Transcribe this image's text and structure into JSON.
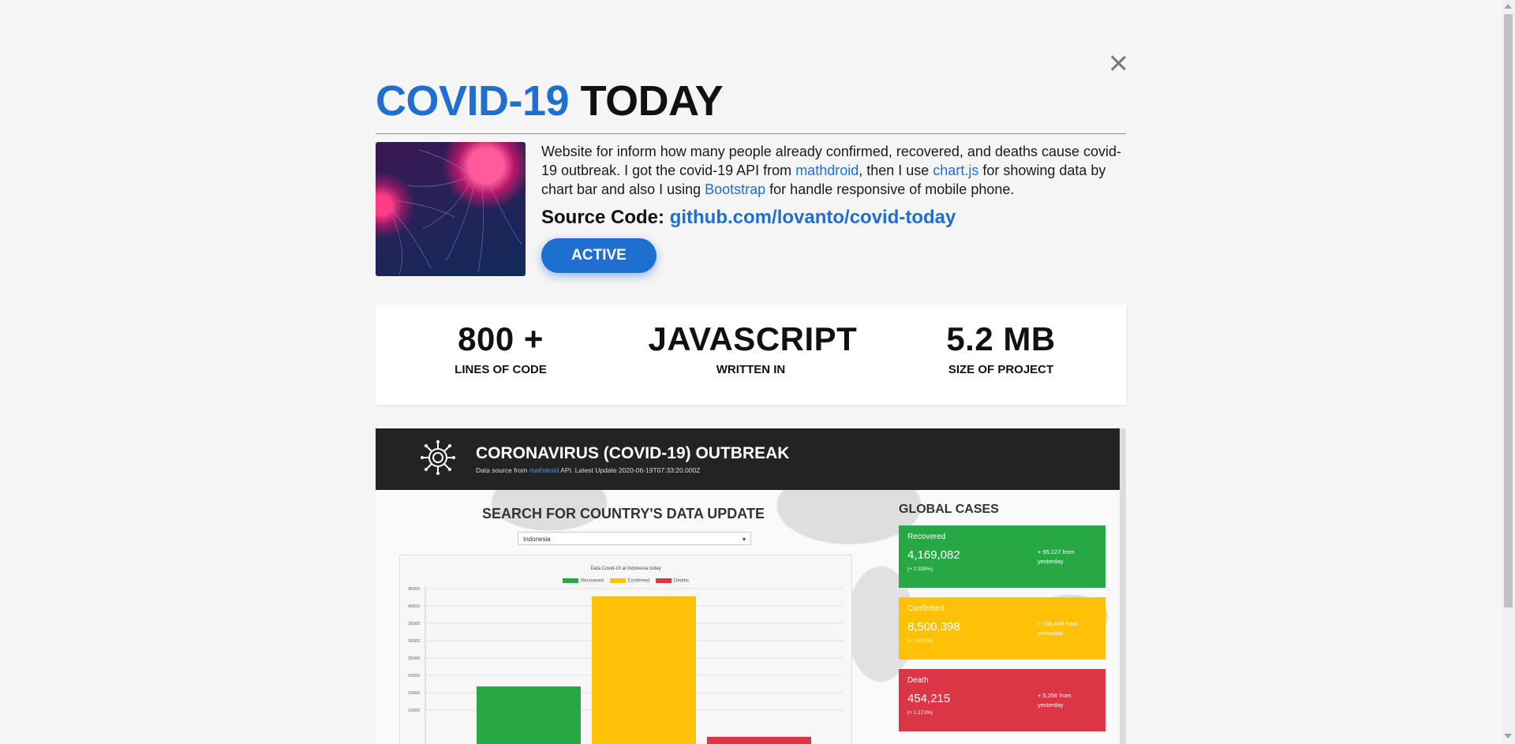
{
  "modal": {
    "title_part1": "COVID-19",
    "title_part2": "TODAY",
    "description": {
      "t1": "Website for inform how many people already confirmed, recovered, and deaths cause covid-19 outbreak. I got the covid-19 API from ",
      "link1": "mathdroid",
      "t2": ", then I use ",
      "link2": "chart.js",
      "t3": " for showing data by chart bar and also I using ",
      "link3": "Bootstrap",
      "t4": " for handle responsive of mobile phone."
    },
    "source_label": "Source Code: ",
    "source_link": "github.com/lovanto/covid-today",
    "status_button": "ACTIVE",
    "stats": [
      {
        "value": "800 +",
        "label": "LINES OF CODE"
      },
      {
        "value": "JAVASCRIPT",
        "label": "WRITTEN IN"
      },
      {
        "value": "5.2 MB",
        "label": "SIZE OF PROJECT"
      }
    ]
  },
  "preview": {
    "header_title": "CORONAVIRUS (COVID-19) OUTBREAK",
    "sub_prefix": "Data source from ",
    "sub_link": "mathdroid",
    "sub_suffix": " API.  Latest Update 2020-06-19T07:33:20.000Z",
    "search_title": "SEARCH FOR COUNTRY'S DATA UPDATE",
    "country_selected": "Indonesia",
    "global_title": "GLOBAL CASES",
    "cases": [
      {
        "label": "Recovered",
        "value": "4,169,082",
        "pct": "(+ 2.335%)",
        "delta": "+ 95,127 from yesterday",
        "color": "#28a745"
      },
      {
        "label": "Confirmed",
        "value": "8,500,398",
        "pct": "(+ 1.802%)",
        "delta": "+ 150,449 from yesterday",
        "color": "#ffc107"
      },
      {
        "label": "Death",
        "value": "454,215",
        "pct": "(+ 1.171%)",
        "delta": "+ 5,256 from yesterday",
        "color": "#dc3545"
      }
    ]
  },
  "chart_data": {
    "type": "bar",
    "title": "Data Covid-19 at Indonesia today",
    "categories": [
      "Recovered",
      "Confirmed",
      "Deaths"
    ],
    "series": [
      {
        "name": "Recovered",
        "color": "#28a745",
        "value": 16800
      },
      {
        "name": "Confirmed",
        "color": "#ffc107",
        "value": 42800
      },
      {
        "name": "Deaths",
        "color": "#dc3545",
        "value": 2300
      }
    ],
    "y_ticks": [
      "45000",
      "40000",
      "35000",
      "30000",
      "25000",
      "20000",
      "15000",
      "10000"
    ],
    "ylim": [
      0,
      45000
    ],
    "grid": true
  }
}
